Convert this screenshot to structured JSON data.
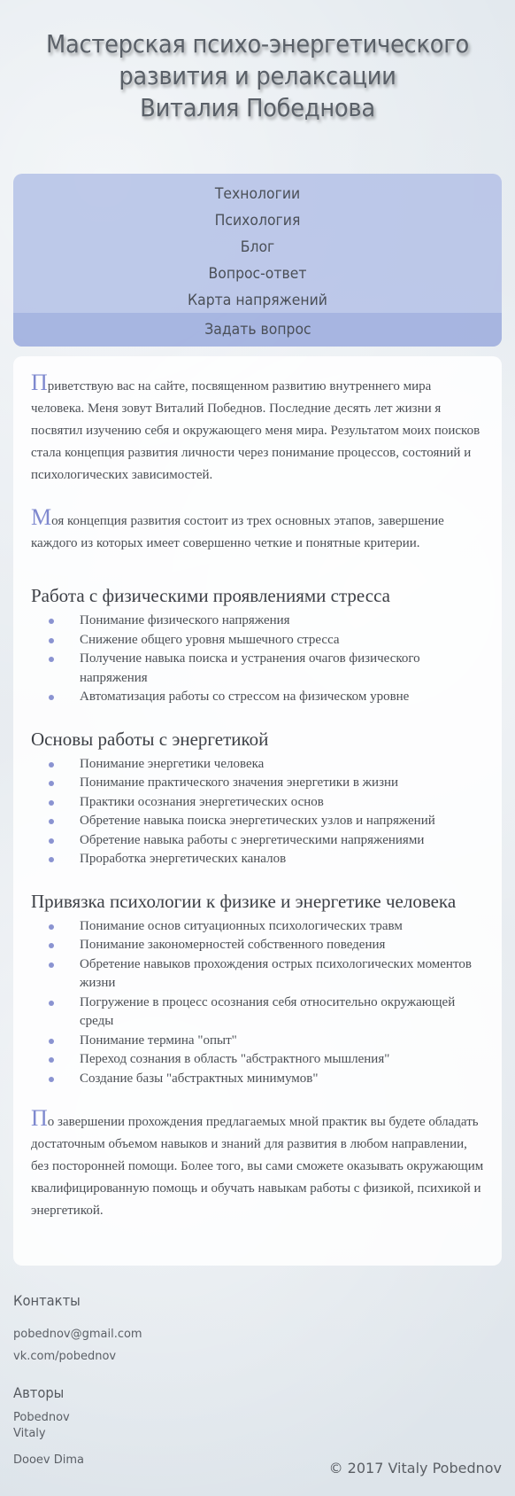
{
  "header": {
    "title_line1": "Мастерская психо-энергетического",
    "title_line2": "развития и релаксации",
    "title_line3": "Виталия Победнова"
  },
  "nav": {
    "items": [
      "Технологии",
      "Психология",
      "Блог",
      "Вопрос-ответ",
      "Карта напряжений"
    ],
    "ask_button": "Задать вопрос"
  },
  "content": {
    "intro": {
      "drop": "П",
      "text": "риветствую вас на сайте, посвященном развитию внутреннего мира человека. Меня зовут Виталий Победнов. Последние десять лет жизни я посвятил изучению себя и окружающего меня мира. Результатом моих поисков стала концепция развития личности через понимание процессов, состояний и психологических зависимостей."
    },
    "concept": {
      "drop": "М",
      "text": "оя концепция развития состоит из трех основных этапов, завершение каждого из которых имеет совершенно четкие и понятные критерии."
    },
    "sections": [
      {
        "title": "Работа с физическими проявлениями стресса",
        "items": [
          "Понимание физического напряжения",
          "Снижение общего уровня мышечного стресса",
          "Получение навыка поиска и устранения очагов физического напряжения",
          "Автоматизация работы со стрессом на физическом уровне"
        ]
      },
      {
        "title": "Основы работы с энергетикой",
        "items": [
          "Понимание энергетики человека",
          "Понимание практического значения энергетики в жизни",
          "Практики осознания энергетических основ",
          "Обретение навыка поиска энергетических узлов и напряжений",
          "Обретение навыка работы с энергетическими напряжениями",
          "Проработка энергетических каналов"
        ]
      },
      {
        "title": "Привязка психологии к физике и энергетике человека",
        "items": [
          "Понимание основ ситуационных психологических травм",
          "Понимание закономерностей собственного поведения",
          "Обретение навыков прохождения острых психологических моментов жизни",
          "Погружение в процесс осознания себя относительно окружающей среды",
          "Понимание термина \"опыт\"",
          "Переход сознания в область \"абстрактного мышления\"",
          "Создание базы \"абстрактных минимумов\""
        ]
      }
    ],
    "final": {
      "drop": "П",
      "text": "о завершении прохождения предлагаемых мной практик вы будете обладать достаточным объемом навыков и знаний для развития в любом направлении, без посторонней помощи. Более того, вы сами сможете оказывать окружающим квалифицированную помощь и обучать навыкам работы с физикой, психикой и энергетикой."
    }
  },
  "footer": {
    "contacts_heading": "Контакты",
    "email": "pobednov@gmail.com",
    "vk": "vk.com/pobednov",
    "authors_heading": "Авторы",
    "author1": "Pobednov Vitaly",
    "author2": "Dooev Dima",
    "copyright": "© 2017 Vitaly Pobednov"
  },
  "colors": {
    "accent": "#7f89cf",
    "nav_bg": "#b4c1e6",
    "bullet": "#8a93d1"
  }
}
